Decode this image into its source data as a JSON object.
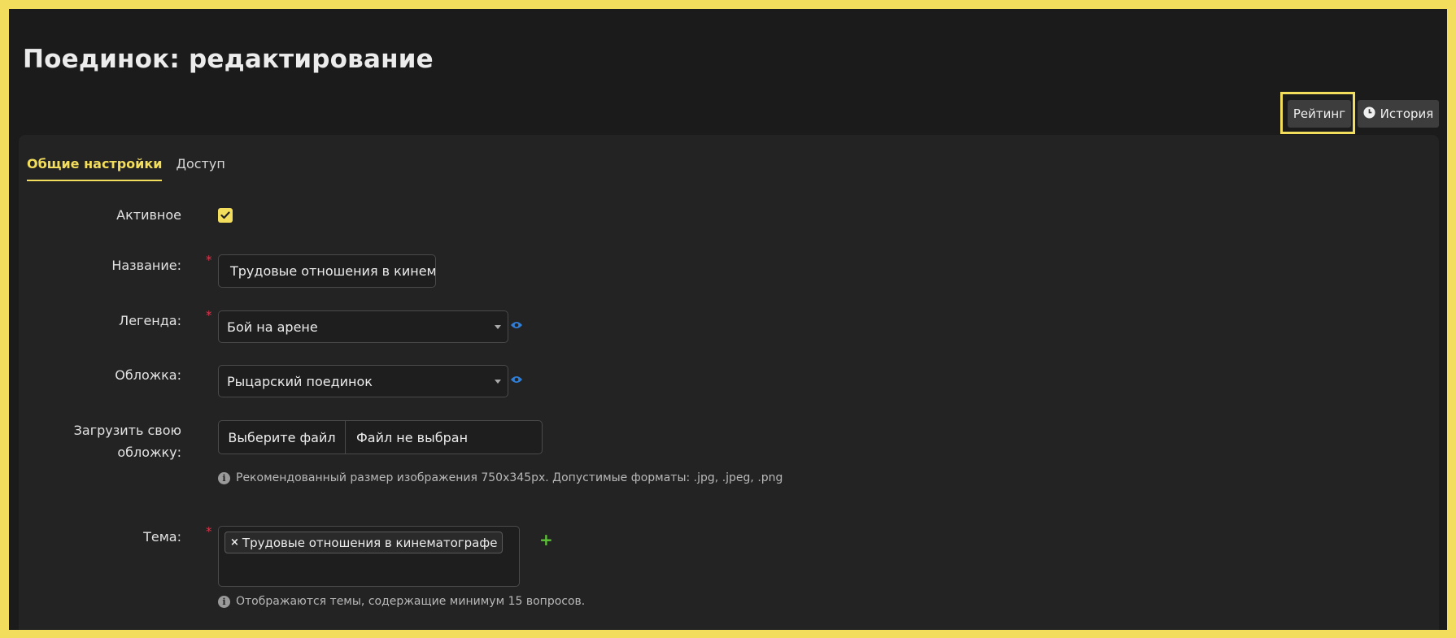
{
  "page": {
    "title": "Поединок: редактирование"
  },
  "toolbar": {
    "rating_label": "Рейтинг",
    "history_label": "История"
  },
  "tabs": [
    {
      "label": "Общие настройки",
      "active": true
    },
    {
      "label": "Доступ",
      "active": false
    }
  ],
  "form": {
    "active": {
      "label": "Активное",
      "checked": true
    },
    "name": {
      "label": "Название:",
      "value": "Трудовые отношения в кинематографе",
      "required_mark": "*"
    },
    "legend": {
      "label": "Легенда:",
      "value": "Бой на арене",
      "required_mark": "*"
    },
    "cover": {
      "label": "Обложка:",
      "value": "Рыцарский поединок"
    },
    "upload": {
      "label_line1": "Загрузить свою",
      "label_line2": "обложку:",
      "button_label": "Выберите файл",
      "file_name": "Файл не выбран",
      "hint": "Рекомендованный размер изображения 750x345px. Допустимые форматы: .jpg, .jpeg, .png"
    },
    "topic": {
      "label": "Тема:",
      "required_mark": "*",
      "tags": [
        "Трудовые отношения в кинематографе"
      ],
      "tag_remove": "×",
      "add": "+",
      "hint": "Отображаются темы, содержащие минимум 15 вопросов."
    }
  },
  "colors": {
    "accent": "#f3dd5c",
    "required": "#e0344b",
    "add": "#5bc236",
    "annotation_arrow": "#e0344b"
  }
}
